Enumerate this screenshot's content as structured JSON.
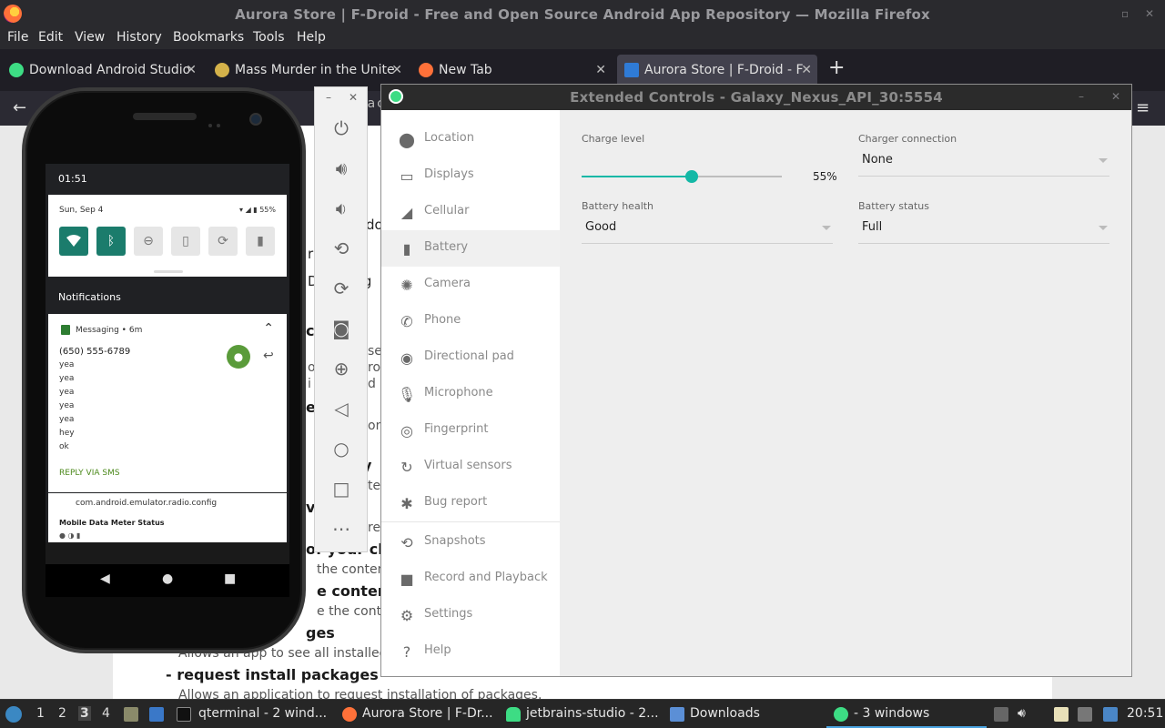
{
  "firefox": {
    "title": "Aurora Store | F-Droid - Free and Open Source Android App Repository — Mozilla Firefox",
    "menu": [
      "File",
      "Edit",
      "View",
      "History",
      "Bookmarks",
      "Tools",
      "Help"
    ],
    "tabs": [
      {
        "label": "Download Android Studio",
        "icon_color": "#3ddc84"
      },
      {
        "label": "Mass Murder in the Unite",
        "icon_color": "#d4b24a"
      },
      {
        "label": "New Tab",
        "icon_color": "#ff7139"
      },
      {
        "label": "Aurora Store | F-Droid - F",
        "icon_color": "#2f7bd6"
      }
    ],
    "url_fragment": "/pa",
    "url_suffix": "co",
    "webpage": {
      "heading_fragments": [
        "do",
        "r n",
        "D",
        "l g"
      ],
      "section_c": "c",
      "section_e": "e",
      "s_fragment": "se",
      "ol_fragment": "ol",
      "ro_fragment": "ro",
      "i_fragment": "i",
      "d_fragment": "d",
      "y_fragment": "y",
      "on_fragment": "on",
      "te_fragment": "te",
      "vi_fragment": "vi",
      "re_fragment": "re",
      "of_your_char": "of your char",
      "the_contents_1": "the contents",
      "e_contents": "e contents",
      "e_the_content": "e the content",
      "ges": "ges",
      "allows_see": "Allows an app to see all installed pa",
      "request_install": "request install packages",
      "allows_request": "Allows an application to request installation of packages."
    }
  },
  "phone": {
    "time": "01:51",
    "date": "Sun, Sep 4",
    "battery_pct": "55%",
    "notifications_header": "Notifications",
    "notif": {
      "app": "Messaging • 6m",
      "from": "(650) 555-6789",
      "lines": [
        "yea",
        "yea",
        "yea",
        "yea",
        "yea",
        "hey",
        "ok"
      ],
      "action": "REPLY VIA SMS"
    },
    "notif2": {
      "title": "com.android.emulator.radio.config",
      "sub": "Mobile Data Meter Status"
    }
  },
  "extended_controls": {
    "title": "Extended Controls - Galaxy_Nexus_API_30:5554",
    "sidebar": [
      {
        "label": "Location",
        "icon": "location-icon"
      },
      {
        "label": "Displays",
        "icon": "display-icon"
      },
      {
        "label": "Cellular",
        "icon": "cellular-icon"
      },
      {
        "label": "Battery",
        "icon": "battery-icon"
      },
      {
        "label": "Camera",
        "icon": "camera-icon"
      },
      {
        "label": "Phone",
        "icon": "phone-icon"
      },
      {
        "label": "Directional pad",
        "icon": "dpad-icon"
      },
      {
        "label": "Microphone",
        "icon": "microphone-icon"
      },
      {
        "label": "Fingerprint",
        "icon": "fingerprint-icon"
      },
      {
        "label": "Virtual sensors",
        "icon": "sensors-icon"
      },
      {
        "label": "Bug report",
        "icon": "bug-icon"
      },
      {
        "label": "Snapshots",
        "icon": "snapshot-icon"
      },
      {
        "label": "Record and Playback",
        "icon": "record-icon"
      },
      {
        "label": "Settings",
        "icon": "gear-icon"
      },
      {
        "label": "Help",
        "icon": "help-icon"
      }
    ],
    "active_item": "Battery",
    "battery": {
      "charge_level_label": "Charge level",
      "charge_level": 55,
      "charge_level_text": "55%",
      "charger_connection_label": "Charger connection",
      "charger_connection": "None",
      "battery_health_label": "Battery health",
      "battery_health": "Good",
      "battery_status_label": "Battery status",
      "battery_status": "Full"
    },
    "accent": "#14b8a6"
  },
  "taskbar": {
    "workspaces": [
      "1",
      "2",
      "3",
      "4"
    ],
    "active_workspace": "3",
    "items": [
      {
        "label": "qterminal - 2 wind..."
      },
      {
        "label": "Aurora Store | F-Dr..."
      },
      {
        "label": "jetbrains-studio - 2..."
      },
      {
        "label": "Downloads"
      },
      {
        "label": "- 3 windows"
      }
    ],
    "clock": "20:51"
  }
}
